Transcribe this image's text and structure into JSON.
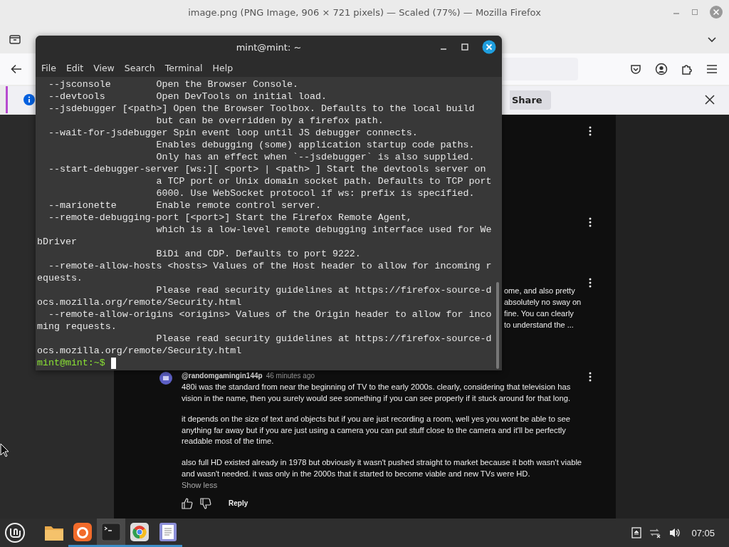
{
  "firefox": {
    "title": "image.png (PNG Image, 906 × 721 pixels) — Scaled (77%) — Mozilla Firefox",
    "notification": {
      "button": "Share"
    },
    "snippet": [
      "ome, and also pretty",
      "absolutely no sway on",
      "fine. You can clearly",
      "to understand the ..."
    ],
    "comment": {
      "author": "@randomgamingin144p",
      "time": "46 minutes ago",
      "paragraphs": [
        [
          "480i was the standard from near the beginning of TV to the early 2000s. clearly, considering that television has",
          "vision in the name, then you surely would see something if you can see properly if it stuck around for that long."
        ],
        [
          "it depends on the size of text and objects but if you are just recording a room, well yes you wont be able to see",
          "anything far away but if you are just using a camera you can put stuff close to the camera and it'll be perfectly",
          "readable most of the time."
        ],
        [
          "also full HD existed already in 1978 but obviously it wasn't pushed straight to market because it both wasn't viable",
          "and wasn't needed. it was only in the 2000s that it started to become viable and new TVs were HD."
        ]
      ],
      "toggle": "Show less",
      "reply": "Reply"
    }
  },
  "terminal": {
    "title": "mint@mint: ~",
    "menu": [
      "File",
      "Edit",
      "View",
      "Search",
      "Terminal",
      "Help"
    ],
    "lines": [
      "  --jsconsole        Open the Browser Console.",
      "  --devtools         Open DevTools on initial load.",
      "  --jsdebugger [<path>] Open the Browser Toolbox. Defaults to the local build",
      "                     but can be overridden by a firefox path.",
      "  --wait-for-jsdebugger Spin event loop until JS debugger connects.",
      "                     Enables debugging (some) application startup code paths.",
      "                     Only has an effect when `--jsdebugger` is also supplied.",
      "  --start-debugger-server [ws:][ <port> | <path> ] Start the devtools server on",
      "                     a TCP port or Unix domain socket path. Defaults to TCP port",
      "                     6000. Use WebSocket protocol if ws: prefix is specified.",
      "  --marionette       Enable remote control server.",
      "  --remote-debugging-port [<port>] Start the Firefox Remote Agent,",
      "                     which is a low-level remote debugging interface used for We",
      "bDriver",
      "                     BiDi and CDP. Defaults to port 9222.",
      "  --remote-allow-hosts <hosts> Values of the Host header to allow for incoming r",
      "equests.",
      "                     Please read security guidelines at https://firefox-source-d",
      "ocs.mozilla.org/remote/Security.html",
      "  --remote-allow-origins <origins> Values of the Origin header to allow for inco",
      "ming requests.",
      "                     Please read security guidelines at https://firefox-source-d",
      "ocs.mozilla.org/remote/Security.html"
    ],
    "prompt": "mint@mint:~$"
  },
  "taskbar": {
    "apps": [
      {
        "kind": "files",
        "running": false,
        "selected": false
      },
      {
        "kind": "firefox",
        "running": true,
        "selected": false
      },
      {
        "kind": "terminal",
        "running": true,
        "selected": true
      },
      {
        "kind": "chrome",
        "running": true,
        "selected": false
      },
      {
        "kind": "editor",
        "running": true,
        "selected": false
      }
    ],
    "clock": "07:05"
  }
}
